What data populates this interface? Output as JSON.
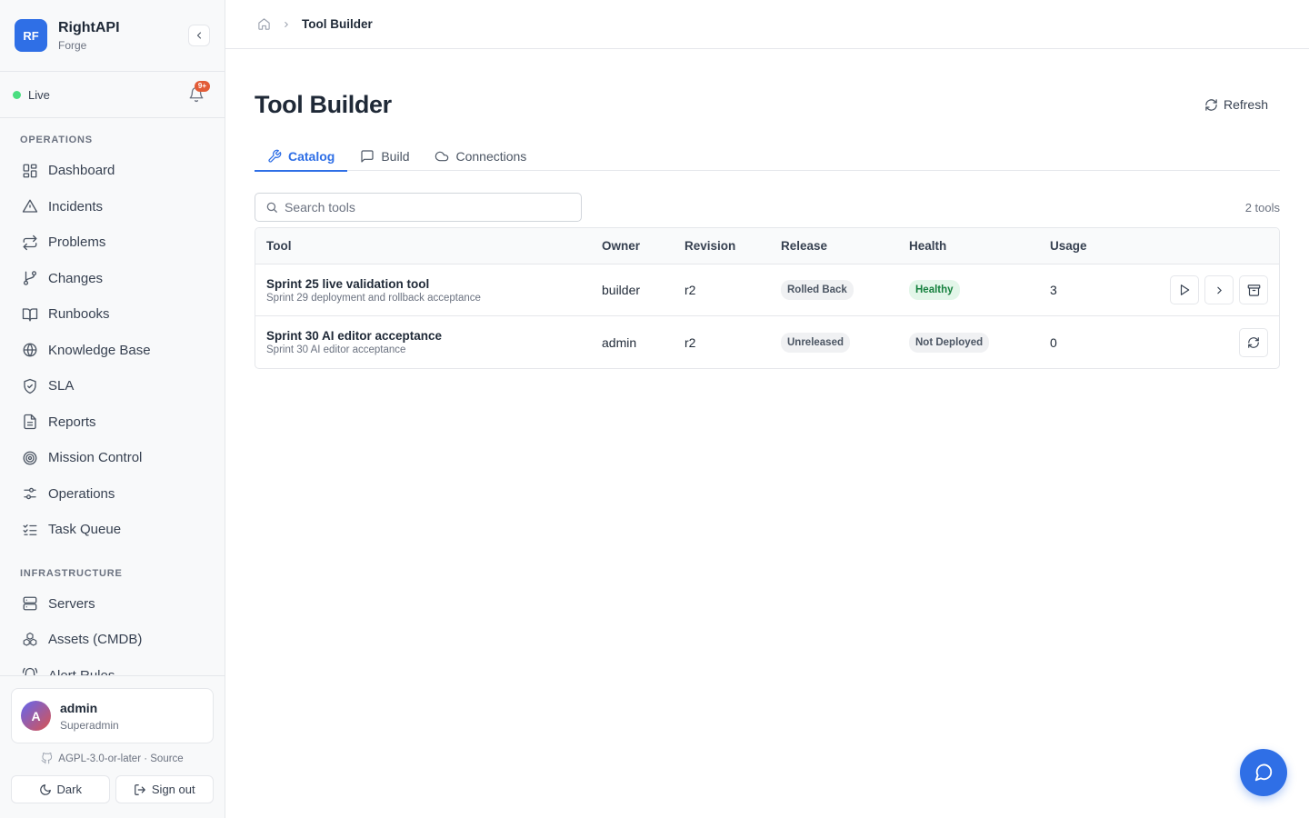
{
  "brand": {
    "logo": "RF",
    "name": "RightAPI",
    "sub": "Forge"
  },
  "status": {
    "label": "Live",
    "badge": "9+"
  },
  "nav": {
    "section1": "OPERATIONS",
    "items1": [
      {
        "label": "Dashboard",
        "icon": "dashboard-icon"
      },
      {
        "label": "Incidents",
        "icon": "alert-triangle-icon"
      },
      {
        "label": "Problems",
        "icon": "repeat-icon"
      },
      {
        "label": "Changes",
        "icon": "git-branch-icon"
      },
      {
        "label": "Runbooks",
        "icon": "book-icon"
      },
      {
        "label": "Knowledge Base",
        "icon": "globe-icon"
      },
      {
        "label": "SLA",
        "icon": "shield-check-icon"
      },
      {
        "label": "Reports",
        "icon": "file-text-icon"
      },
      {
        "label": "Mission Control",
        "icon": "target-icon"
      },
      {
        "label": "Operations",
        "icon": "sliders-icon"
      },
      {
        "label": "Task Queue",
        "icon": "list-checks-icon"
      }
    ],
    "section2": "INFRASTRUCTURE",
    "items2": [
      {
        "label": "Servers",
        "icon": "server-icon"
      },
      {
        "label": "Assets (CMDB)",
        "icon": "boxes-icon"
      },
      {
        "label": "Alert Rules",
        "icon": "bell-ring-icon"
      }
    ]
  },
  "user": {
    "initial": "A",
    "name": "admin",
    "role": "Superadmin"
  },
  "footer": {
    "license": "AGPL-3.0-or-later · Source",
    "dark_label": "Dark",
    "signout_label": "Sign out"
  },
  "breadcrumb": {
    "current": "Tool Builder"
  },
  "page": {
    "title": "Tool Builder",
    "refresh_label": "Refresh"
  },
  "tabs": [
    {
      "label": "Catalog",
      "icon": "wrench-icon",
      "active": true
    },
    {
      "label": "Build",
      "icon": "message-square-icon",
      "active": false
    },
    {
      "label": "Connections",
      "icon": "cloud-icon",
      "active": false
    }
  ],
  "search": {
    "placeholder": "Search tools",
    "value": ""
  },
  "tool_count": "2 tools",
  "table": {
    "headers": [
      "Tool",
      "Owner",
      "Revision",
      "Release",
      "Health",
      "Usage"
    ],
    "rows": [
      {
        "name": "Sprint 25 live validation tool",
        "desc": "Sprint 29 deployment and rollback acceptance",
        "owner": "builder",
        "revision": "r2",
        "release": "Rolled Back",
        "health": "Healthy",
        "usage": "3"
      },
      {
        "name": "Sprint 30 AI editor acceptance",
        "desc": "Sprint 30 AI editor acceptance",
        "owner": "admin",
        "revision": "r2",
        "release": "Unreleased",
        "health": "Not Deployed",
        "usage": "0"
      }
    ]
  },
  "colors": {
    "accent": "#2f6fe6",
    "live": "#4ade80",
    "badge": "#e25c37",
    "healthy_bg": "#e3f6e9",
    "healthy_text": "#15803d"
  }
}
